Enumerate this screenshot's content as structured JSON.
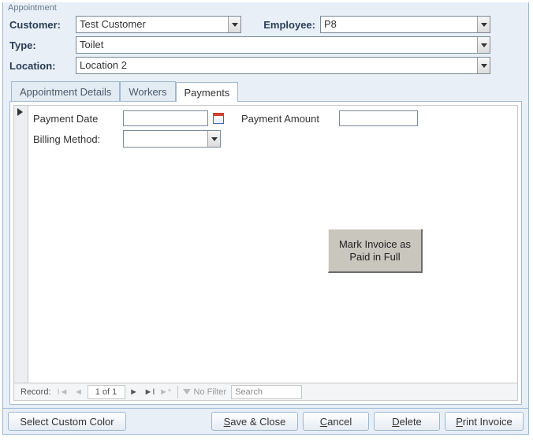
{
  "window": {
    "title": "Appointment"
  },
  "header": {
    "customer": {
      "label": "Customer:",
      "value": "Test Customer"
    },
    "employee": {
      "label": "Employee:",
      "value": "P8"
    },
    "type": {
      "label": "Type:",
      "value": "Toilet"
    },
    "location": {
      "label": "Location:",
      "value": "Location 2"
    }
  },
  "tabs": {
    "details": "Appointment Details",
    "workers": "Workers",
    "payments": "Payments",
    "active": "payments"
  },
  "payments": {
    "payment_date": {
      "label": "Payment Date",
      "value": ""
    },
    "payment_amount": {
      "label": "Payment Amount",
      "value": ""
    },
    "billing_method": {
      "label": "Billing Method:",
      "value": ""
    },
    "mark_paid": "Mark Invoice as\nPaid in Full"
  },
  "recordnav": {
    "label": "Record:",
    "position": "1 of 1",
    "no_filter": "No Filter",
    "search_placeholder": "Search"
  },
  "footer": {
    "select_color": "Select Custom Color",
    "save_close": {
      "u": "S",
      "rest": "ave & Close"
    },
    "cancel": {
      "u": "C",
      "rest": "ancel"
    },
    "delete": {
      "u": "D",
      "rest": "elete"
    },
    "print_invoice": {
      "u": "P",
      "rest": "rint Invoice"
    }
  }
}
